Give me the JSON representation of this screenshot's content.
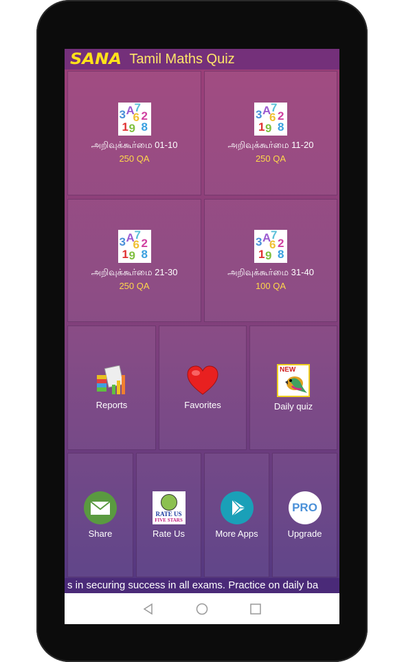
{
  "app": {
    "brand": "SANA",
    "title": "Tamil Maths Quiz"
  },
  "quiz_sets": [
    {
      "label": "அறிவுக்கூர்மை 01-10",
      "count": "250 QA",
      "icon": "numbers-icon"
    },
    {
      "label": "அறிவுக்கூர்மை 11-20",
      "count": "250 QA",
      "icon": "numbers-icon"
    },
    {
      "label": "அறிவுக்கூர்மை 21-30",
      "count": "250 QA",
      "icon": "numbers-icon"
    },
    {
      "label": "அறிவுக்கூர்மை 31-40",
      "count": "100 QA",
      "icon": "numbers-icon"
    }
  ],
  "features": [
    {
      "label": "Reports",
      "icon": "reports-icon"
    },
    {
      "label": "Favorites",
      "icon": "heart-icon"
    },
    {
      "label": "Daily quiz",
      "icon": "new-bird-icon",
      "badge": "NEW"
    }
  ],
  "actions": [
    {
      "label": "Share",
      "icon": "mail-icon"
    },
    {
      "label": "Rate Us",
      "icon": "rate-us-icon",
      "icon_text": "RATE US",
      "icon_subtext": "FIVE STARS"
    },
    {
      "label": "More Apps",
      "icon": "play-store-icon"
    },
    {
      "label": "Upgrade",
      "icon": "pro-icon",
      "icon_text": "PRO"
    }
  ],
  "ticker": "s in securing success in all exams. Practice on daily ba",
  "colors": {
    "title_bar": "#74307a",
    "brand": "#ffe21a",
    "qa_count": "#ffd84a"
  }
}
